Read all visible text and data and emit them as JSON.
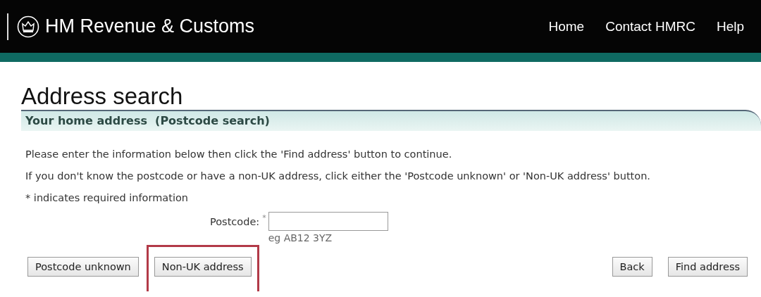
{
  "header": {
    "brand": "HM Revenue & Customs",
    "nav": [
      "Home",
      "Contact HMRC",
      "Help"
    ]
  },
  "page_title": "Address search",
  "section_title": "Your home address  (Postcode search)",
  "paragraphs": [
    "Please enter the information below then click the 'Find address' button to continue.",
    "If you don't know the postcode or have a non-UK address, click either the 'Postcode unknown' or 'Non-UK address' button.",
    "* indicates required information"
  ],
  "postcode": {
    "label": "Postcode:",
    "required_mark": "*",
    "hint": "eg AB12 3YZ"
  },
  "left_buttons": [
    {
      "label": "Postcode unknown",
      "highlighted": false
    },
    {
      "label": "Non-UK address",
      "highlighted": true
    }
  ],
  "right_buttons": [
    {
      "label": "Back",
      "highlighted": false
    },
    {
      "label": "Find address",
      "highlighted": false
    }
  ]
}
